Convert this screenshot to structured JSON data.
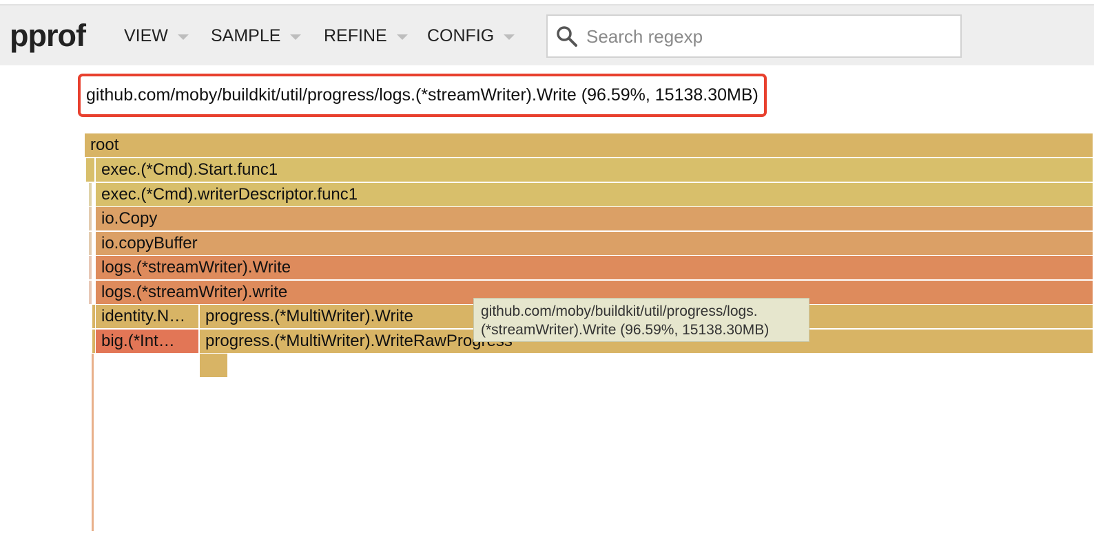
{
  "app": {
    "title": "pprof"
  },
  "menu": {
    "view": "VIEW",
    "sample": "SAMPLE",
    "refine": "REFINE",
    "config": "CONFIG"
  },
  "search": {
    "placeholder": "Search regexp",
    "value": ""
  },
  "current_frame": "github.com/moby/buildkit/util/progress/logs.(*streamWriter).Write (96.59%, 15138.30MB)",
  "flame": {
    "root": "root",
    "start_func1": "exec.(*Cmd).Start.func1",
    "writer_descriptor": "exec.(*Cmd).writerDescriptor.func1",
    "io_copy": "io.Copy",
    "io_copy_buffer": "io.copyBuffer",
    "stream_writer_write": "logs.(*streamWriter).Write",
    "stream_writer_write_lower": "logs.(*streamWriter).write",
    "identity": "identity.N…",
    "multiwriter_write": "progress.(*MultiWriter).Write",
    "big_int": "big.(*Int…",
    "multiwriter_write_raw": "progress.(*MultiWriter).WriteRawProgress"
  },
  "tooltip": {
    "line1": "github.com/moby/buildkit/util/progress/logs.",
    "line2": "(*streamWriter).Write (96.59%, 15138.30MB)"
  },
  "colors": {
    "root": "#d8b465",
    "exec": "#d8bf6b",
    "io": "#dba066",
    "logs": "#de8b5c",
    "progress": "#d8b465",
    "big": "#e27656",
    "highlight": "#e8402e",
    "tooltip_bg": "#e6e6cd"
  }
}
